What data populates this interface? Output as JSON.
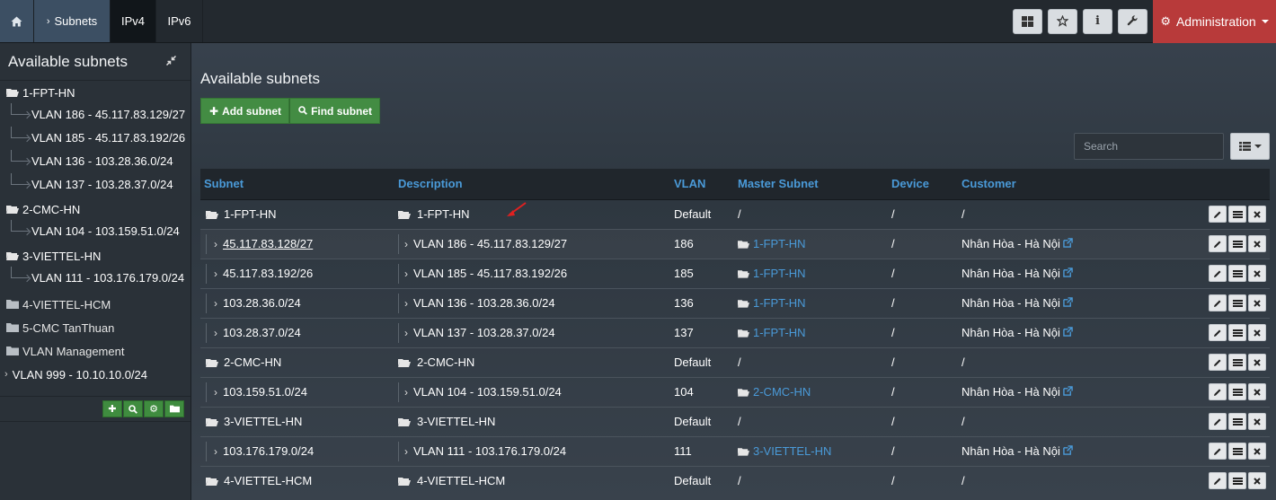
{
  "topbar": {
    "home_icon": "home-icon",
    "breadcrumb": "Subnets",
    "tabs": [
      {
        "label": "IPv4",
        "active": true
      },
      {
        "label": "IPv6",
        "active": false
      }
    ],
    "tools": [
      "dashboard-icon",
      "star-icon",
      "info-icon",
      "wrench-icon"
    ],
    "admin_label": "Administration"
  },
  "sidebar": {
    "title": "Available subnets",
    "groups": [
      {
        "label": "1-FPT-HN",
        "items": [
          "VLAN 186 - 45.117.83.129/27",
          "VLAN 185 - 45.117.83.192/26",
          "VLAN 136 - 103.28.36.0/24",
          "VLAN 137 - 103.28.37.0/24"
        ]
      },
      {
        "label": "2-CMC-HN",
        "items": [
          "VLAN 104 - 103.159.51.0/24"
        ]
      },
      {
        "label": "3-VIETTEL-HN",
        "items": [
          "VLAN 111 - 103.176.179.0/24"
        ]
      },
      {
        "label": "4-VIETTEL-HCM",
        "items": []
      },
      {
        "label": "5-CMC TanThuan",
        "items": []
      },
      {
        "label": "VLAN Management",
        "items": []
      }
    ],
    "loose_item": "VLAN 999 - 10.10.10.0/24"
  },
  "main": {
    "title": "Available subnets",
    "add_subnet": "Add subnet",
    "find_subnet": "Find subnet",
    "search_placeholder": "Search"
  },
  "table": {
    "headers": [
      "Subnet",
      "Description",
      "VLAN",
      "Master Subnet",
      "Device",
      "Customer"
    ],
    "rows": [
      {
        "type": "group",
        "subnet": "1-FPT-HN",
        "description": "1-FPT-HN",
        "vlan": "Default",
        "master": "/",
        "device": "/",
        "customer": "/"
      },
      {
        "type": "child",
        "subnet": "45.117.83.128/27",
        "description": "VLAN 186 - 45.117.83.129/27",
        "vlan": "186",
        "master": "1-FPT-HN",
        "device": "/",
        "customer": "Nhân Hòa - Hà Nội"
      },
      {
        "type": "child",
        "subnet": "45.117.83.192/26",
        "description": "VLAN 185 - 45.117.83.192/26",
        "vlan": "185",
        "master": "1-FPT-HN",
        "device": "/",
        "customer": "Nhân Hòa - Hà Nội"
      },
      {
        "type": "child",
        "subnet": "103.28.36.0/24",
        "description": "VLAN 136 - 103.28.36.0/24",
        "vlan": "136",
        "master": "1-FPT-HN",
        "device": "/",
        "customer": "Nhân Hòa - Hà Nội"
      },
      {
        "type": "child",
        "subnet": "103.28.37.0/24",
        "description": "VLAN 137 - 103.28.37.0/24",
        "vlan": "137",
        "master": "1-FPT-HN",
        "device": "/",
        "customer": "Nhân Hòa - Hà Nội"
      },
      {
        "type": "group",
        "subnet": "2-CMC-HN",
        "description": "2-CMC-HN",
        "vlan": "Default",
        "master": "/",
        "device": "/",
        "customer": "/"
      },
      {
        "type": "child",
        "subnet": "103.159.51.0/24",
        "description": "VLAN 104 - 103.159.51.0/24",
        "vlan": "104",
        "master": "2-CMC-HN",
        "device": "/",
        "customer": "Nhân Hòa - Hà Nội"
      },
      {
        "type": "group",
        "subnet": "3-VIETTEL-HN",
        "description": "3-VIETTEL-HN",
        "vlan": "Default",
        "master": "/",
        "device": "/",
        "customer": "/"
      },
      {
        "type": "child",
        "subnet": "103.176.179.0/24",
        "description": "VLAN 111 - 103.176.179.0/24",
        "vlan": "111",
        "master": "3-VIETTEL-HN",
        "device": "/",
        "customer": "Nhân Hòa - Hà Nội"
      },
      {
        "type": "group",
        "subnet": "4-VIETTEL-HCM",
        "description": "4-VIETTEL-HCM",
        "vlan": "Default",
        "master": "/",
        "device": "/",
        "customer": "/"
      }
    ]
  },
  "colors": {
    "link": "#4a9ad8",
    "admin": "#b83a3a",
    "green": "#438c43"
  }
}
